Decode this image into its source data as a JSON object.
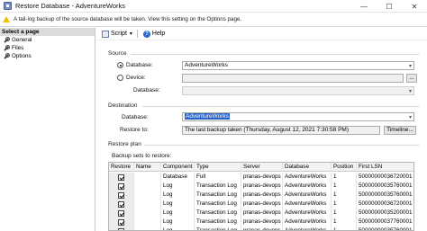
{
  "window": {
    "title": "Restore Database - AdventureWorks",
    "minimize": "—",
    "maximize": "☐",
    "close": "✕"
  },
  "warning": {
    "icon": "warning-icon",
    "text": "A tail-log backup of the source database will be taken. View this setting on the Options page."
  },
  "left_pane": {
    "header": "Select a page",
    "items": [
      {
        "label": "General",
        "icon": "wrench-icon"
      },
      {
        "label": "Files",
        "icon": "wrench-icon"
      },
      {
        "label": "Options",
        "icon": "wrench-icon"
      }
    ]
  },
  "toolbar": {
    "script_label": "Script",
    "script_arrow": "▾",
    "help_label": "Help",
    "help_glyph": "?"
  },
  "source": {
    "group_label": "Source",
    "database_radio_label": "Database:",
    "database_value": "AdventureWorks",
    "device_radio_label": "Device:",
    "device_value": "",
    "device_browse": "...",
    "db_label": "Database:",
    "db_value": ""
  },
  "destination": {
    "group_label": "Destination",
    "database_label": "Database:",
    "database_value": "AdventureWorks",
    "restore_to_label": "Restore to:",
    "restore_to_value": "The last backup taken (Thursday, August 12, 2021 7:30:58 PM)",
    "timeline_button": "Timeline..."
  },
  "restore_plan": {
    "group_label": "Restore plan",
    "sets_label": "Backup sets to restore:",
    "columns": [
      "Restore",
      "Name",
      "Component",
      "Type",
      "Server",
      "Database",
      "Position",
      "First LSN"
    ],
    "rows": [
      {
        "restore": true,
        "name": "",
        "component": "Database",
        "type": "Full",
        "server": "pranas-devops",
        "database": "AdventureWorks",
        "position": "1",
        "first_lsn": "50000000036720001"
      },
      {
        "restore": true,
        "name": "",
        "component": "Log",
        "type": "Transaction Log",
        "server": "pranas-devops",
        "database": "AdventureWorks",
        "position": "1",
        "first_lsn": "50000000035760001"
      },
      {
        "restore": true,
        "name": "",
        "component": "Log",
        "type": "Transaction Log",
        "server": "pranas-devops",
        "database": "AdventureWorks",
        "position": "1",
        "first_lsn": "50000000035760001"
      },
      {
        "restore": true,
        "name": "",
        "component": "Log",
        "type": "Transaction Log",
        "server": "pranas-devops",
        "database": "AdventureWorks",
        "position": "1",
        "first_lsn": "50000000036720001"
      },
      {
        "restore": true,
        "name": "",
        "component": "Log",
        "type": "Transaction Log",
        "server": "pranas-devops",
        "database": "AdventureWorks",
        "position": "1",
        "first_lsn": "50000000035200001"
      },
      {
        "restore": true,
        "name": "",
        "component": "Log",
        "type": "Transaction Log",
        "server": "pranas-devops",
        "database": "AdventureWorks",
        "position": "1",
        "first_lsn": "50000000037760001"
      },
      {
        "restore": true,
        "name": "",
        "component": "Log",
        "type": "Transaction Log",
        "server": "pranas-devops",
        "database": "AdventureWorks",
        "position": "1",
        "first_lsn": "50000000035760001"
      }
    ]
  },
  "colors": {
    "selection": "#2a63c7",
    "warning": "#f2c200"
  }
}
